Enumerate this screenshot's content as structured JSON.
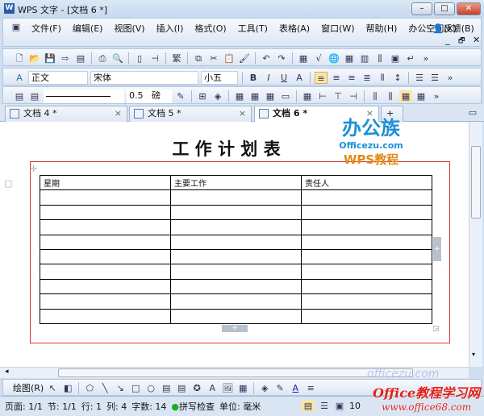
{
  "window": {
    "title": "WPS 文字 - [文档 6 *]",
    "app_icon": "W",
    "min": "–",
    "max": "□",
    "close": "✕"
  },
  "menu": [
    "文件(F)",
    "编辑(E)",
    "视图(V)",
    "插入(I)",
    "格式(O)",
    "工具(T)",
    "表格(A)",
    "窗口(W)",
    "帮助(H)",
    "办公空间(K)"
  ],
  "feedback": "反馈(B)",
  "doc_controls": {
    "min": "_",
    "restore": "🗗",
    "close": "✕"
  },
  "format": {
    "style": "正文",
    "font": "宋体",
    "size": "小五",
    "bold": "B",
    "italic": "I",
    "underline": "U",
    "fontcolor": "A"
  },
  "table_toolbar": {
    "line_width": "0.5",
    "unit": "磅"
  },
  "tabs": [
    {
      "label": "文档 4 *"
    },
    {
      "label": "文档 5 *"
    },
    {
      "label": "文档 6 *",
      "active": true
    }
  ],
  "document": {
    "title": "工 作 计 划 表",
    "headers": [
      "星期",
      "主要工作",
      "责任人"
    ],
    "empty_rows": 9
  },
  "drawing": {
    "label": "绘图(R)"
  },
  "status": {
    "page": "页面: 1/1",
    "section": "节: 1/1",
    "row": "行: 1",
    "col": "列: 4",
    "words": "字数: 14",
    "spell": "拼写检查",
    "unit": "单位: 毫米",
    "zoom": "10"
  },
  "watermarks": {
    "logo_top": "办公族",
    "logo_url": "Officezu.com",
    "logo_sub": "WPS教程",
    "bottom": "Office教程学习网",
    "bottom_url": "www.office68.com",
    "faint": "officezu.com"
  },
  "colors": {
    "page_border": "#d33",
    "accent": "#2b5aa8"
  }
}
